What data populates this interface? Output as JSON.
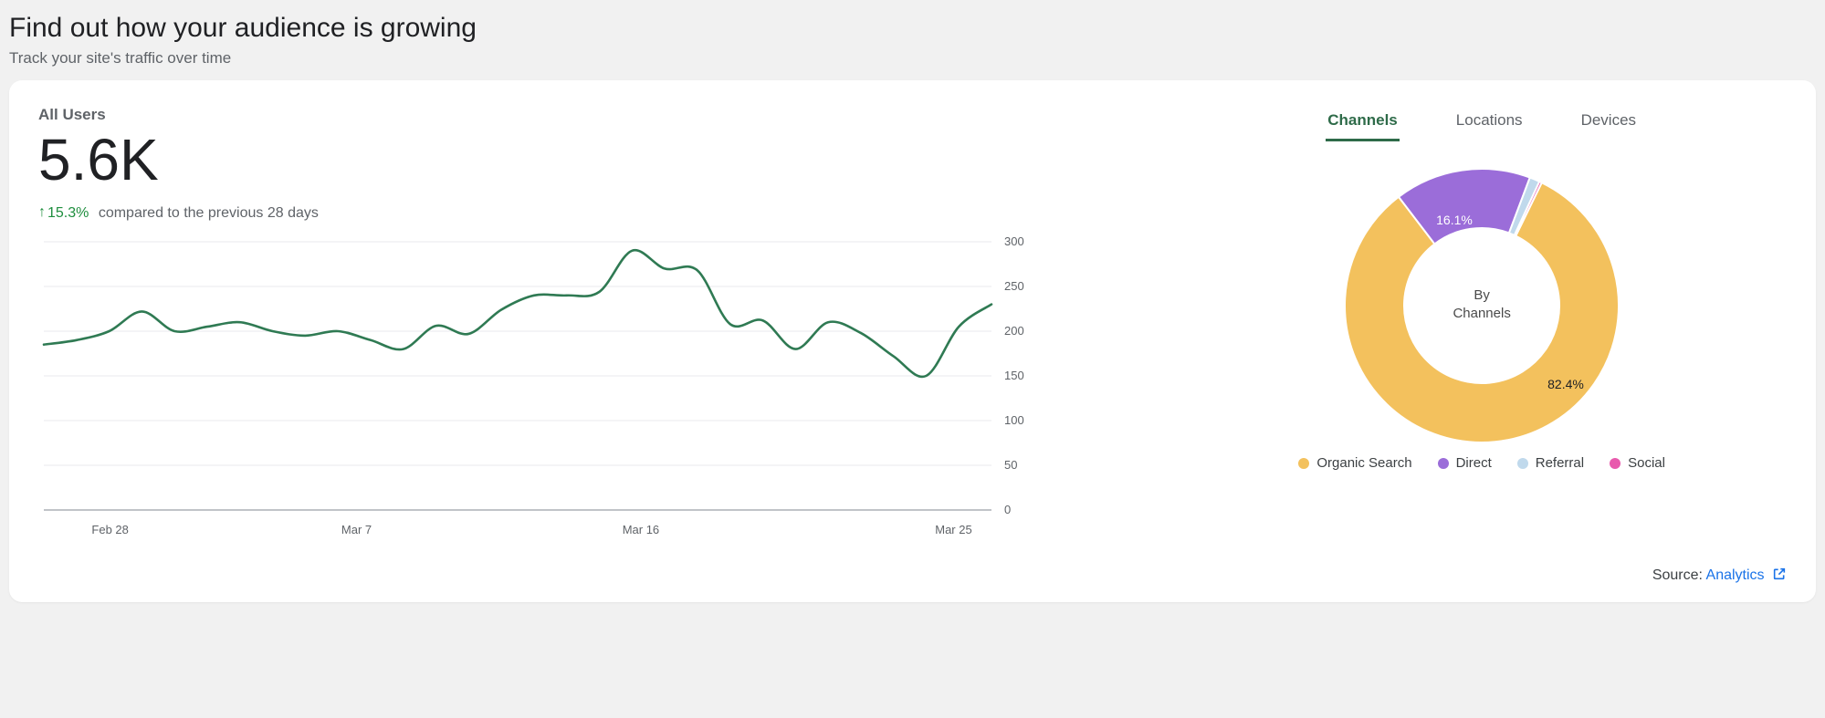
{
  "header": {
    "title": "Find out how your audience is growing",
    "subtitle": "Track your site's traffic over time"
  },
  "left": {
    "label": "All Users",
    "value": "5.6K",
    "delta": "15.3%",
    "delta_suffix": "compared to the previous 28 days"
  },
  "tabs": {
    "channels": "Channels",
    "locations": "Locations",
    "devices": "Devices"
  },
  "donut": {
    "center_line1": "By",
    "center_line2": "Channels",
    "label_big": "82.4%",
    "label_small": "16.1%"
  },
  "legend": {
    "organic": "Organic Search",
    "direct": "Direct",
    "referral": "Referral",
    "social": "Social"
  },
  "source": {
    "prefix": "Source: ",
    "link": "Analytics"
  },
  "chart_data": {
    "type": "line+donut",
    "line": {
      "type": "line",
      "title": "All Users",
      "xlabel": "",
      "ylabel": "",
      "ylim": [
        0,
        300
      ],
      "y_ticks": [
        0,
        50,
        100,
        150,
        200,
        250,
        300
      ],
      "x_ticks": [
        "Feb 28",
        "Mar 7",
        "Mar 16",
        "Mar 25"
      ],
      "x": [
        "Feb 26",
        "Feb 27",
        "Feb 28",
        "Feb 29",
        "Mar 1",
        "Mar 2",
        "Mar 3",
        "Mar 4",
        "Mar 5",
        "Mar 6",
        "Mar 7",
        "Mar 8",
        "Mar 9",
        "Mar 10",
        "Mar 11",
        "Mar 12",
        "Mar 13",
        "Mar 14",
        "Mar 15",
        "Mar 16",
        "Mar 17",
        "Mar 18",
        "Mar 19",
        "Mar 20",
        "Mar 21",
        "Mar 22",
        "Mar 23",
        "Mar 24",
        "Mar 25",
        "Mar 26"
      ],
      "values": [
        185,
        190,
        200,
        222,
        200,
        205,
        210,
        200,
        195,
        200,
        190,
        180,
        206,
        197,
        224,
        240,
        240,
        244,
        290,
        270,
        268,
        208,
        212,
        180,
        210,
        198,
        172,
        150,
        205,
        230
      ]
    },
    "donut": {
      "type": "pie",
      "title": "By Channels",
      "series": [
        {
          "name": "Organic Search",
          "value": 82.4,
          "color": "#f3c15d"
        },
        {
          "name": "Direct",
          "value": 16.1,
          "color": "#9b6dd9"
        },
        {
          "name": "Referral",
          "value": 1.2,
          "color": "#c0d9ec"
        },
        {
          "name": "Social",
          "value": 0.3,
          "color": "#e85aad"
        }
      ]
    }
  }
}
